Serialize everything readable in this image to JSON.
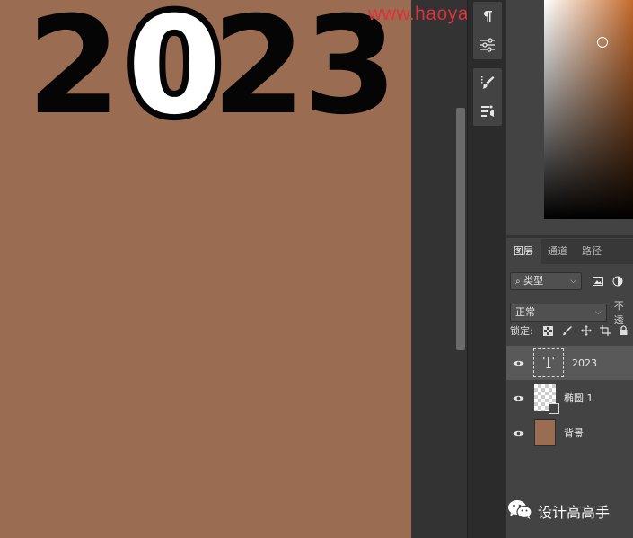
{
  "canvas": {
    "digits": [
      "2",
      "0",
      "2",
      "3"
    ],
    "doc_color": "#9a6c52"
  },
  "watermark": "www.haoyanhansheji.com",
  "toolbar": {
    "icons": [
      "paragraph-icon",
      "adjustments-icon",
      "brush-settings-icon",
      "tool-presets-icon"
    ]
  },
  "layers_panel": {
    "tabs": [
      "图层",
      "通道",
      "路径"
    ],
    "filter_label": "类型",
    "blend_mode": "正常",
    "opacity_label": "不透",
    "lock_label": "锁定:",
    "layers": [
      {
        "name": "2023",
        "type": "text",
        "visible": true,
        "selected": true,
        "thumb_glyph": "T"
      },
      {
        "name": "椭圆 1",
        "type": "shape",
        "visible": true,
        "selected": false
      },
      {
        "name": "背景",
        "type": "fill",
        "visible": true,
        "selected": false,
        "color": "#9a6c52"
      }
    ]
  },
  "footer": {
    "brand": "设计高高手"
  }
}
